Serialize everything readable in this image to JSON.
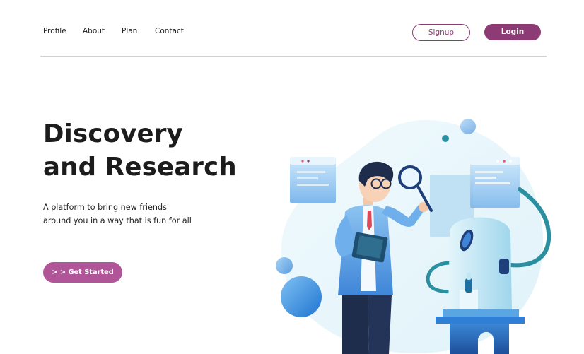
{
  "nav": {
    "links": [
      {
        "label": "Profile"
      },
      {
        "label": "About"
      },
      {
        "label": "Plan"
      },
      {
        "label": "Contact"
      }
    ],
    "signup_label": "Signup",
    "login_label": "Login"
  },
  "hero": {
    "title_line1": "Discovery",
    "title_line2": "and Research",
    "subtitle_line1": "A platform to bring new friends",
    "subtitle_line2": "around you in a way that is fun for all",
    "cta_label": "> > Get Started"
  },
  "illustration": {
    "icon": "scientist-with-magnifier-illustration"
  },
  "colors": {
    "brand": "#8c3b74",
    "cta": "#b05698",
    "accent_blue": "#2f7fd6"
  }
}
